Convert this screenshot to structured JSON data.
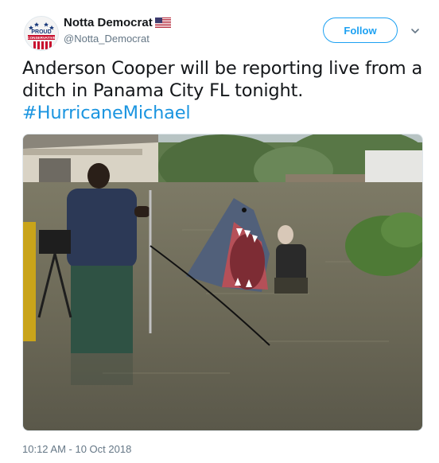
{
  "author": {
    "display_name": "Notta Democrat",
    "handle": "@Notta_Democrat",
    "avatar_text": [
      "PROUD",
      "CONSERVATIVE"
    ]
  },
  "follow_button": {
    "label": "Follow"
  },
  "tweet": {
    "text_line1": "Anderson Cooper will be reporting live from a",
    "text_line2": "ditch in Panama City FL tonight.",
    "hashtag": "#HurricaneMichael"
  },
  "timestamp": "10:12 AM - 10 Oct 2018",
  "colors": {
    "accent": "#1da1f2",
    "hashtag": "#1b95e0",
    "secondary_text": "#657786"
  },
  "icons": [
    "us-flag-icon",
    "chevron-down-icon"
  ]
}
